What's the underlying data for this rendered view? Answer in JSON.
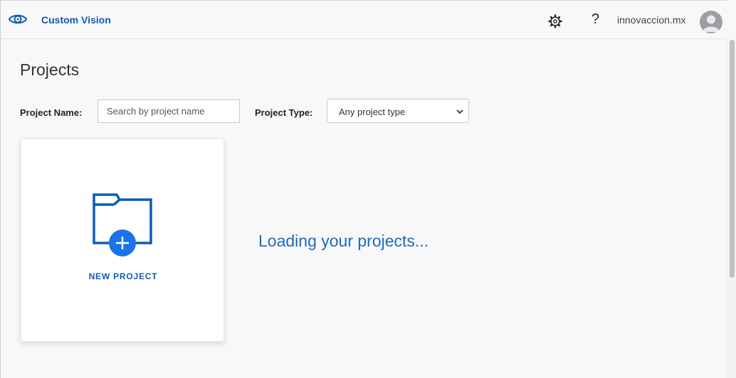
{
  "header": {
    "app_name": "Custom Vision",
    "help_label": "?",
    "user_name": "innovaccion.mx"
  },
  "page": {
    "title": "Projects"
  },
  "filters": {
    "name_label": "Project Name:",
    "search_placeholder": "Search by project name",
    "type_label": "Project Type:",
    "type_selected": "Any project type"
  },
  "new_project": {
    "label": "NEW PROJECT"
  },
  "status": {
    "loading_text": "Loading your projects..."
  },
  "colors": {
    "brand": "#0f5bb5",
    "accent": "#1a73e8",
    "loading": "#1a6bc2"
  }
}
